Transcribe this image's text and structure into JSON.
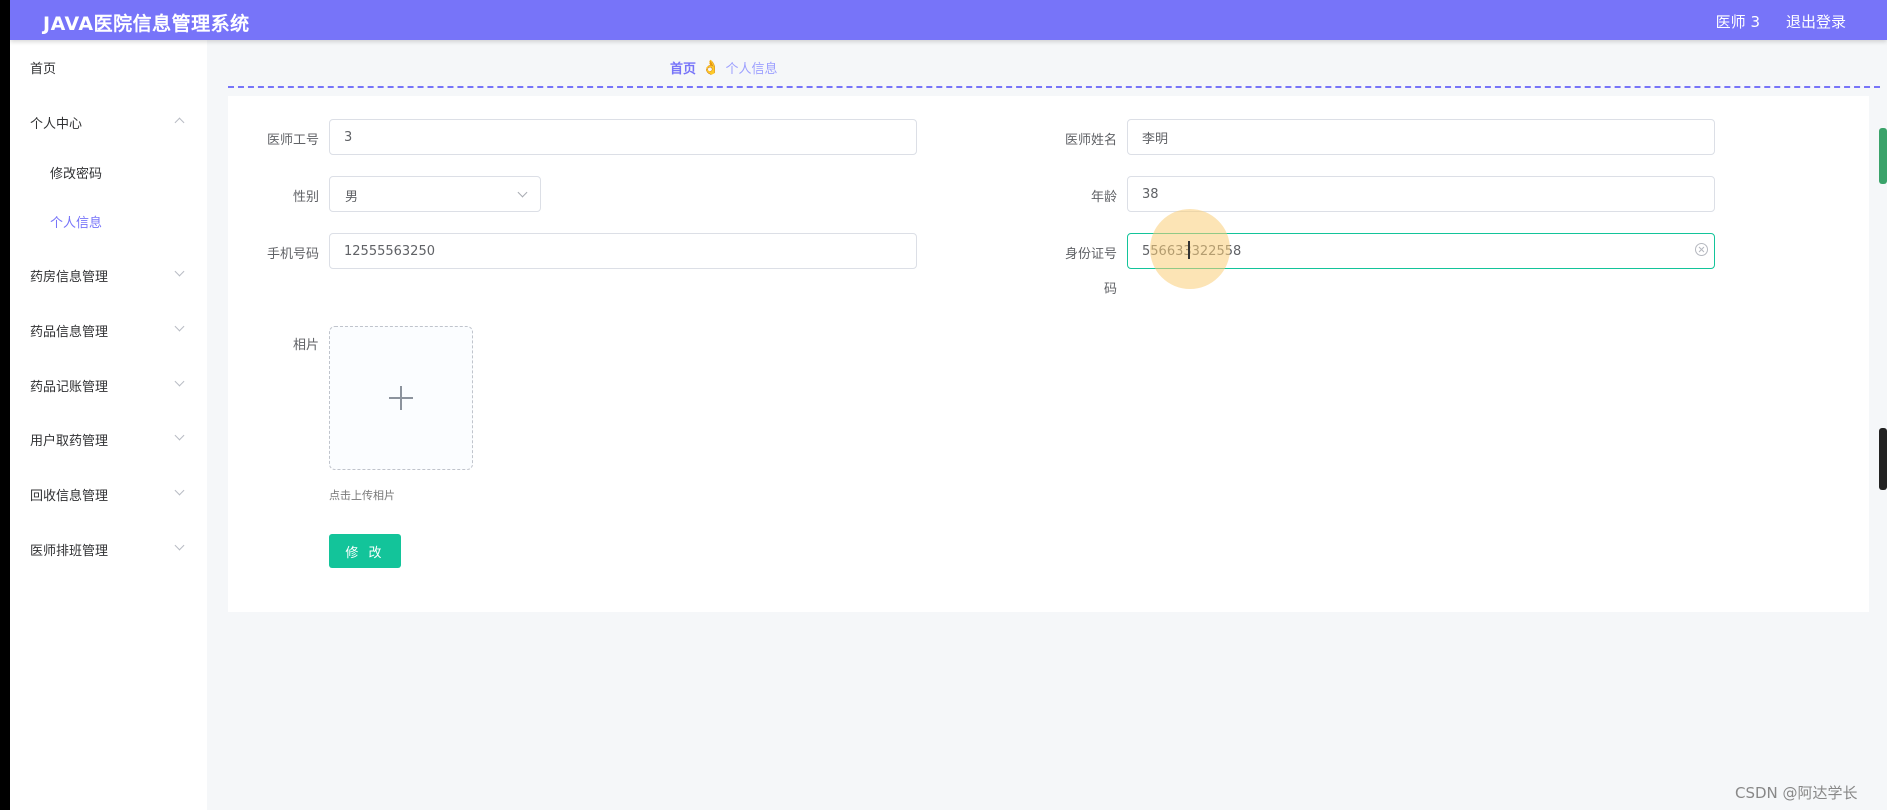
{
  "header": {
    "title": "JAVA医院信息管理系统",
    "user": "医师 3",
    "logout": "退出登录"
  },
  "sidebar": {
    "items": [
      {
        "label": "首页"
      },
      {
        "label": "个人中心",
        "expanded": true
      },
      {
        "label": "修改密码"
      },
      {
        "label": "个人信息",
        "active": true
      },
      {
        "label": "药房信息管理"
      },
      {
        "label": "药品信息管理"
      },
      {
        "label": "药品记账管理"
      },
      {
        "label": "用户取药管理"
      },
      {
        "label": "回收信息管理"
      },
      {
        "label": "医师排班管理"
      }
    ]
  },
  "breadcrumb": {
    "home": "首页",
    "separator": "👌",
    "current": "个人信息"
  },
  "form": {
    "doctor_id": {
      "label": "医师工号",
      "value": "3"
    },
    "doctor_name": {
      "label": "医师姓名",
      "value": "李明"
    },
    "gender": {
      "label": "性别",
      "value": "男"
    },
    "age": {
      "label": "年龄",
      "value": "38"
    },
    "phone": {
      "label": "手机号码",
      "value": "12555563250"
    },
    "id_number": {
      "label_line1": "身份证号",
      "label_line2": "码",
      "value": "556633322558"
    },
    "photo": {
      "label": "相片",
      "hint": "点击上传相片"
    },
    "submit_label": "修 改"
  },
  "colors": {
    "accent": "#7774f9",
    "button": "#13c49a"
  },
  "watermark": "CSDN @阿达学长"
}
